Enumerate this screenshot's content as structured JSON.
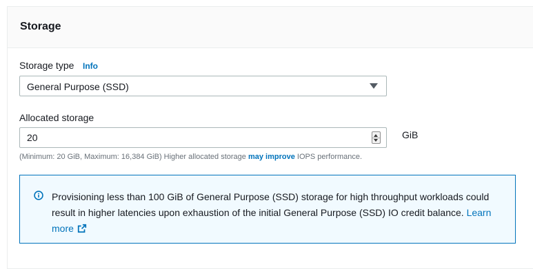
{
  "panel": {
    "title": "Storage"
  },
  "storage_type": {
    "label": "Storage type",
    "info_link": "Info",
    "selected_value": "General Purpose (SSD)"
  },
  "allocated_storage": {
    "label": "Allocated storage",
    "value": "20",
    "unit": "GiB",
    "hint_prefix": "(Minimum: 20 GiB, Maximum: 16,384 GiB) Higher allocated storage ",
    "hint_link": "may improve",
    "hint_suffix": " IOPS performance."
  },
  "alert": {
    "message": "Provisioning less than 100 GiB of General Purpose (SSD) storage for high throughput workloads could result in higher latencies upon exhaustion of the initial General Purpose (SSD) IO credit balance. ",
    "link_label": "Learn more",
    "icon": "info-circle-icon",
    "link_icon": "external-link-icon"
  },
  "colors": {
    "link": "#0073bb",
    "alert_border": "#0073bb",
    "alert_background": "#f1faff"
  }
}
